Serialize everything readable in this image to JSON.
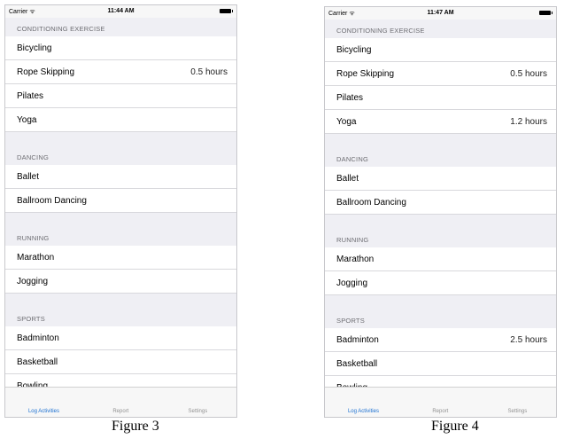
{
  "figure3": {
    "status": {
      "carrier": "Carrier ᯤ",
      "time": "11:44 AM"
    },
    "sections": [
      {
        "header": "CONDITIONING EXERCISE",
        "rows": [
          {
            "label": "Bicycling",
            "detail": ""
          },
          {
            "label": "Rope Skipping",
            "detail": "0.5 hours"
          },
          {
            "label": "Pilates",
            "detail": ""
          },
          {
            "label": "Yoga",
            "detail": ""
          }
        ]
      },
      {
        "header": "DANCING",
        "rows": [
          {
            "label": "Ballet",
            "detail": ""
          },
          {
            "label": "Ballroom Dancing",
            "detail": ""
          }
        ]
      },
      {
        "header": "RUNNING",
        "rows": [
          {
            "label": "Marathon",
            "detail": ""
          },
          {
            "label": "Jogging",
            "detail": ""
          }
        ]
      },
      {
        "header": "SPORTS",
        "rows": [
          {
            "label": "Badminton",
            "detail": ""
          },
          {
            "label": "Basketball",
            "detail": ""
          },
          {
            "label": "Bowling",
            "detail": ""
          }
        ]
      }
    ],
    "tabs": [
      "Log Activities",
      "Report",
      "Settings"
    ],
    "caption": "Figure 3"
  },
  "figure4": {
    "status": {
      "carrier": "Carrier ᯤ",
      "time": "11:47 AM"
    },
    "sections": [
      {
        "header": "CONDITIONING EXERCISE",
        "rows": [
          {
            "label": "Bicycling",
            "detail": ""
          },
          {
            "label": "Rope Skipping",
            "detail": "0.5 hours"
          },
          {
            "label": "Pilates",
            "detail": ""
          },
          {
            "label": "Yoga",
            "detail": "1.2 hours"
          }
        ]
      },
      {
        "header": "DANCING",
        "rows": [
          {
            "label": "Ballet",
            "detail": ""
          },
          {
            "label": "Ballroom Dancing",
            "detail": ""
          }
        ]
      },
      {
        "header": "RUNNING",
        "rows": [
          {
            "label": "Marathon",
            "detail": ""
          },
          {
            "label": "Jogging",
            "detail": ""
          }
        ]
      },
      {
        "header": "SPORTS",
        "rows": [
          {
            "label": "Badminton",
            "detail": "2.5 hours"
          },
          {
            "label": "Basketball",
            "detail": ""
          },
          {
            "label": "Bowling",
            "detail": ""
          }
        ]
      }
    ],
    "tabs": [
      "Log Activities",
      "Report",
      "Settings"
    ],
    "caption": "Figure 4"
  },
  "colors": {
    "accent": "#1a6fd1",
    "section_bg": "#efeff4",
    "separator": "#d8d8dc"
  }
}
